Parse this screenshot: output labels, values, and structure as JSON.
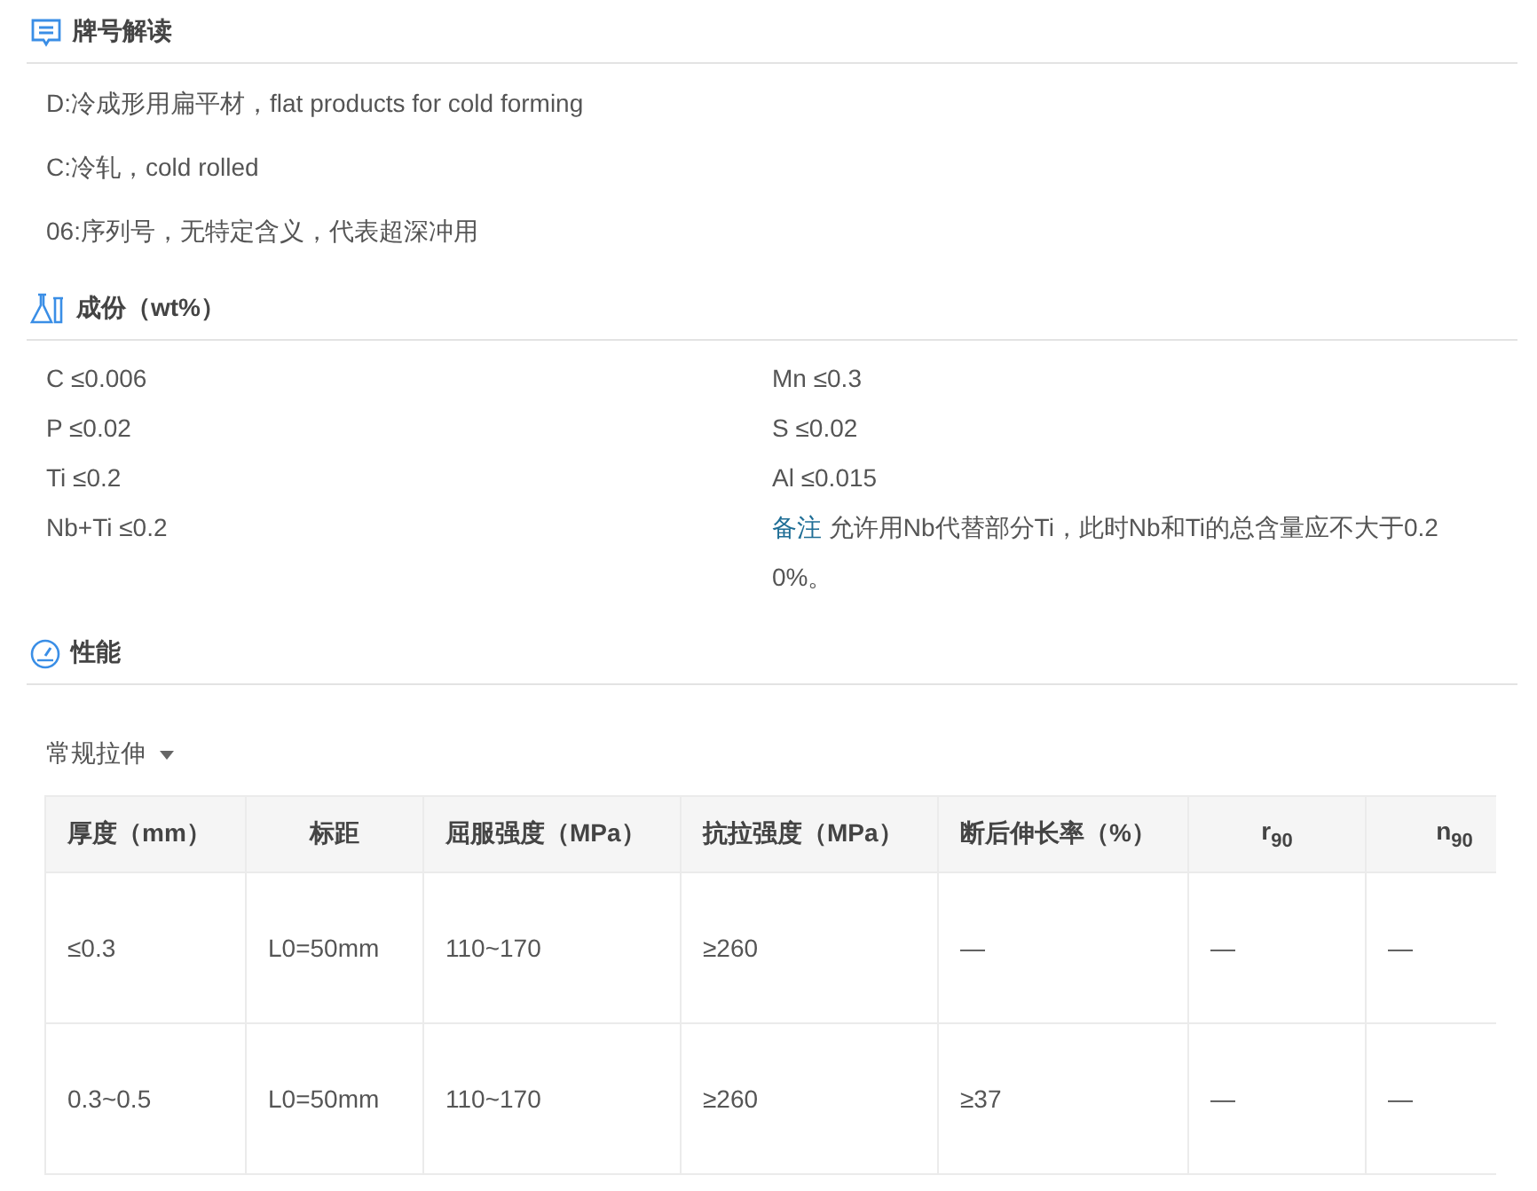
{
  "designation": {
    "title": "牌号解读",
    "items": [
      "D:冷成形用扁平材，flat products for cold forming",
      "C:冷轧，cold rolled",
      "06:序列号，无特定含义，代表超深冲用"
    ]
  },
  "composition": {
    "title": "成份（wt%）",
    "items": [
      {
        "kind": "element",
        "text": "C ≤0.006"
      },
      {
        "kind": "element",
        "text": "Mn ≤0.3"
      },
      {
        "kind": "element",
        "text": "P ≤0.02"
      },
      {
        "kind": "element",
        "text": "S ≤0.02"
      },
      {
        "kind": "element",
        "text": "Ti ≤0.2"
      },
      {
        "kind": "element",
        "text": "Al ≤0.015"
      },
      {
        "kind": "element",
        "text": "Nb+Ti ≤0.2"
      },
      {
        "kind": "note",
        "label": "备注",
        "text": "允许用Nb代替部分Ti，此时Nb和Ti的总含量应不大于0.20%。"
      }
    ]
  },
  "properties": {
    "title": "性能",
    "test_type": "常规拉伸",
    "table": {
      "columns": [
        "厚度（mm）",
        "标距",
        "屈服强度（MPa）",
        "抗拉强度（MPa）",
        "断后伸长率（%）",
        "r$_{90}$",
        "n$_{90}$"
      ],
      "rows": [
        [
          "≤0.3",
          "L0=50mm",
          "110~170",
          "≥260",
          "—",
          "—",
          "—"
        ],
        [
          "0.3~0.5",
          "L0=50mm",
          "110~170",
          "≥260",
          "≥37",
          "—",
          "—"
        ]
      ]
    }
  }
}
